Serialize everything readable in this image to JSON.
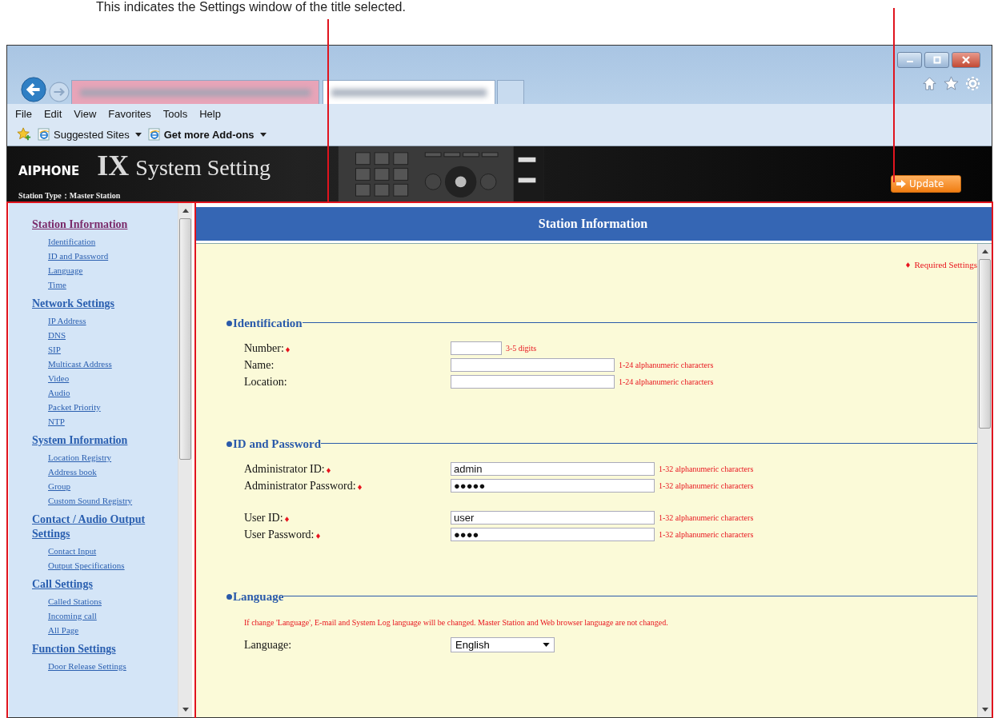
{
  "annotation": {
    "text": "This indicates the Settings window of the title selected."
  },
  "browser": {
    "menu": [
      "File",
      "Edit",
      "View",
      "Favorites",
      "Tools",
      "Help"
    ],
    "favorites": [
      {
        "label": "Suggested Sites",
        "emphasized": false
      },
      {
        "label": "Get more Add-ons",
        "emphasized": true
      }
    ]
  },
  "header": {
    "brand": "AIPHONE",
    "logo_mark": "IX",
    "title": "System Setting",
    "station_type": "Station Type：Master Station",
    "update_button": "Update"
  },
  "sidebar": {
    "groups": [
      {
        "title": "Station Information",
        "visited": true,
        "items": [
          "Identification",
          "ID and Password",
          "Language",
          "Time"
        ]
      },
      {
        "title": "Network Settings",
        "visited": false,
        "items": [
          "IP Address",
          "DNS",
          "SIP",
          "Multicast Address",
          "Video",
          "Audio",
          "Packet Priority",
          "NTP"
        ]
      },
      {
        "title": "System Information",
        "visited": false,
        "items": [
          "Location Registry",
          "Address book",
          "Group",
          "Custom Sound Registry"
        ]
      },
      {
        "title": "Contact / Audio Output Settings",
        "visited": false,
        "items": [
          "Contact Input",
          "Output Specifications"
        ]
      },
      {
        "title": "Call Settings",
        "visited": false,
        "items": [
          "Called Stations",
          "Incoming call",
          "All Page"
        ]
      },
      {
        "title": "Function Settings",
        "visited": false,
        "items": [
          "Door Release Settings"
        ]
      }
    ]
  },
  "main": {
    "title": "Station Information",
    "required_note": "Required Settings",
    "sections": [
      {
        "title": "Identification",
        "groups": [
          [
            {
              "label": "Number:",
              "required": true,
              "kind": "short",
              "hint": "3-5 digits"
            },
            {
              "label": "Name:",
              "required": false,
              "kind": "medium",
              "hint": "1-24 alphanumeric characters"
            },
            {
              "label": "Location:",
              "required": false,
              "kind": "medium",
              "hint": "1-24 alphanumeric characters"
            }
          ]
        ]
      },
      {
        "title": "ID and Password",
        "groups": [
          [
            {
              "label": "Administrator ID:",
              "required": true,
              "kind": "wide",
              "value": "admin",
              "hint": "1-32 alphanumeric characters"
            },
            {
              "label": "Administrator Password:",
              "required": true,
              "kind": "wide",
              "value": "●●●●●",
              "hint": "1-32 alphanumeric characters"
            }
          ],
          [
            {
              "label": "User ID:",
              "required": true,
              "kind": "wide",
              "value": "user",
              "hint": "1-32 alphanumeric characters"
            },
            {
              "label": "User Password:",
              "required": true,
              "kind": "wide",
              "value": "●●●●",
              "hint": "1-32 alphanumeric characters"
            }
          ]
        ]
      },
      {
        "title": "Language",
        "note": "If change 'Language', E-mail and System Log language will be changed. Master Station and Web browser language are not changed.",
        "groups": [
          [
            {
              "label": "Language:",
              "required": false,
              "kind": "select",
              "value": "English"
            }
          ]
        ]
      }
    ]
  }
}
